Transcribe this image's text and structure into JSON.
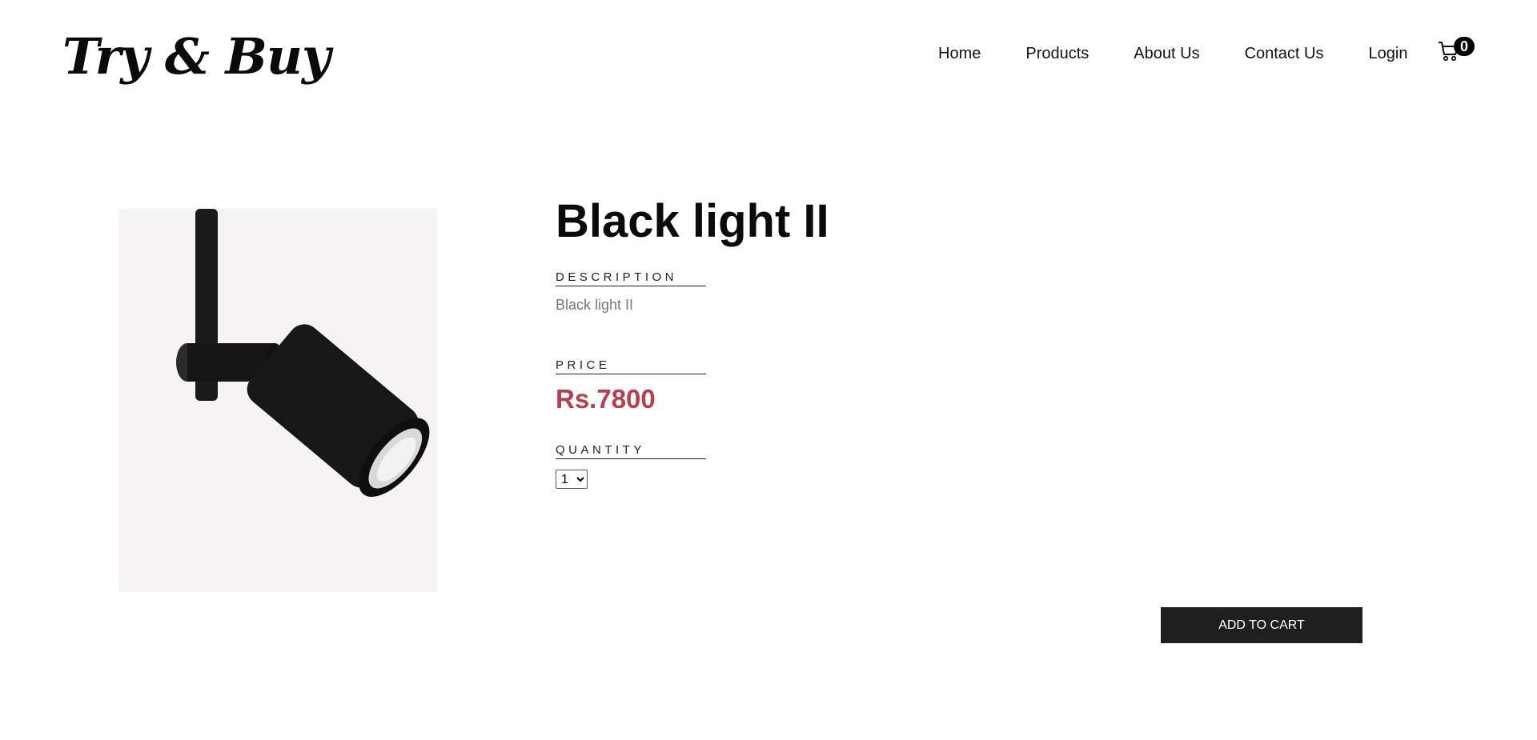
{
  "brand": {
    "logo_text": "Try & Buy"
  },
  "nav": {
    "items": [
      {
        "label": "Home"
      },
      {
        "label": "Products"
      },
      {
        "label": "About Us"
      },
      {
        "label": "Contact Us"
      },
      {
        "label": "Login"
      }
    ],
    "cart_count": "0",
    "cart_icon": "cart-icon"
  },
  "product": {
    "title": "Black light II",
    "description_label": "DESCRIPTION",
    "description": "Black light II",
    "price_label": "PRICE",
    "price": "Rs.7800",
    "quantity_label": "QUANTITY",
    "quantity_value": "1",
    "quantity_options": [
      "1"
    ],
    "add_to_cart_label": "ADD TO CART",
    "image_alt": "black spotlight lamp"
  },
  "colors": {
    "price": "#b6404f",
    "button_bg": "#1f1f1f",
    "image_bg": "#f5f3f3"
  }
}
